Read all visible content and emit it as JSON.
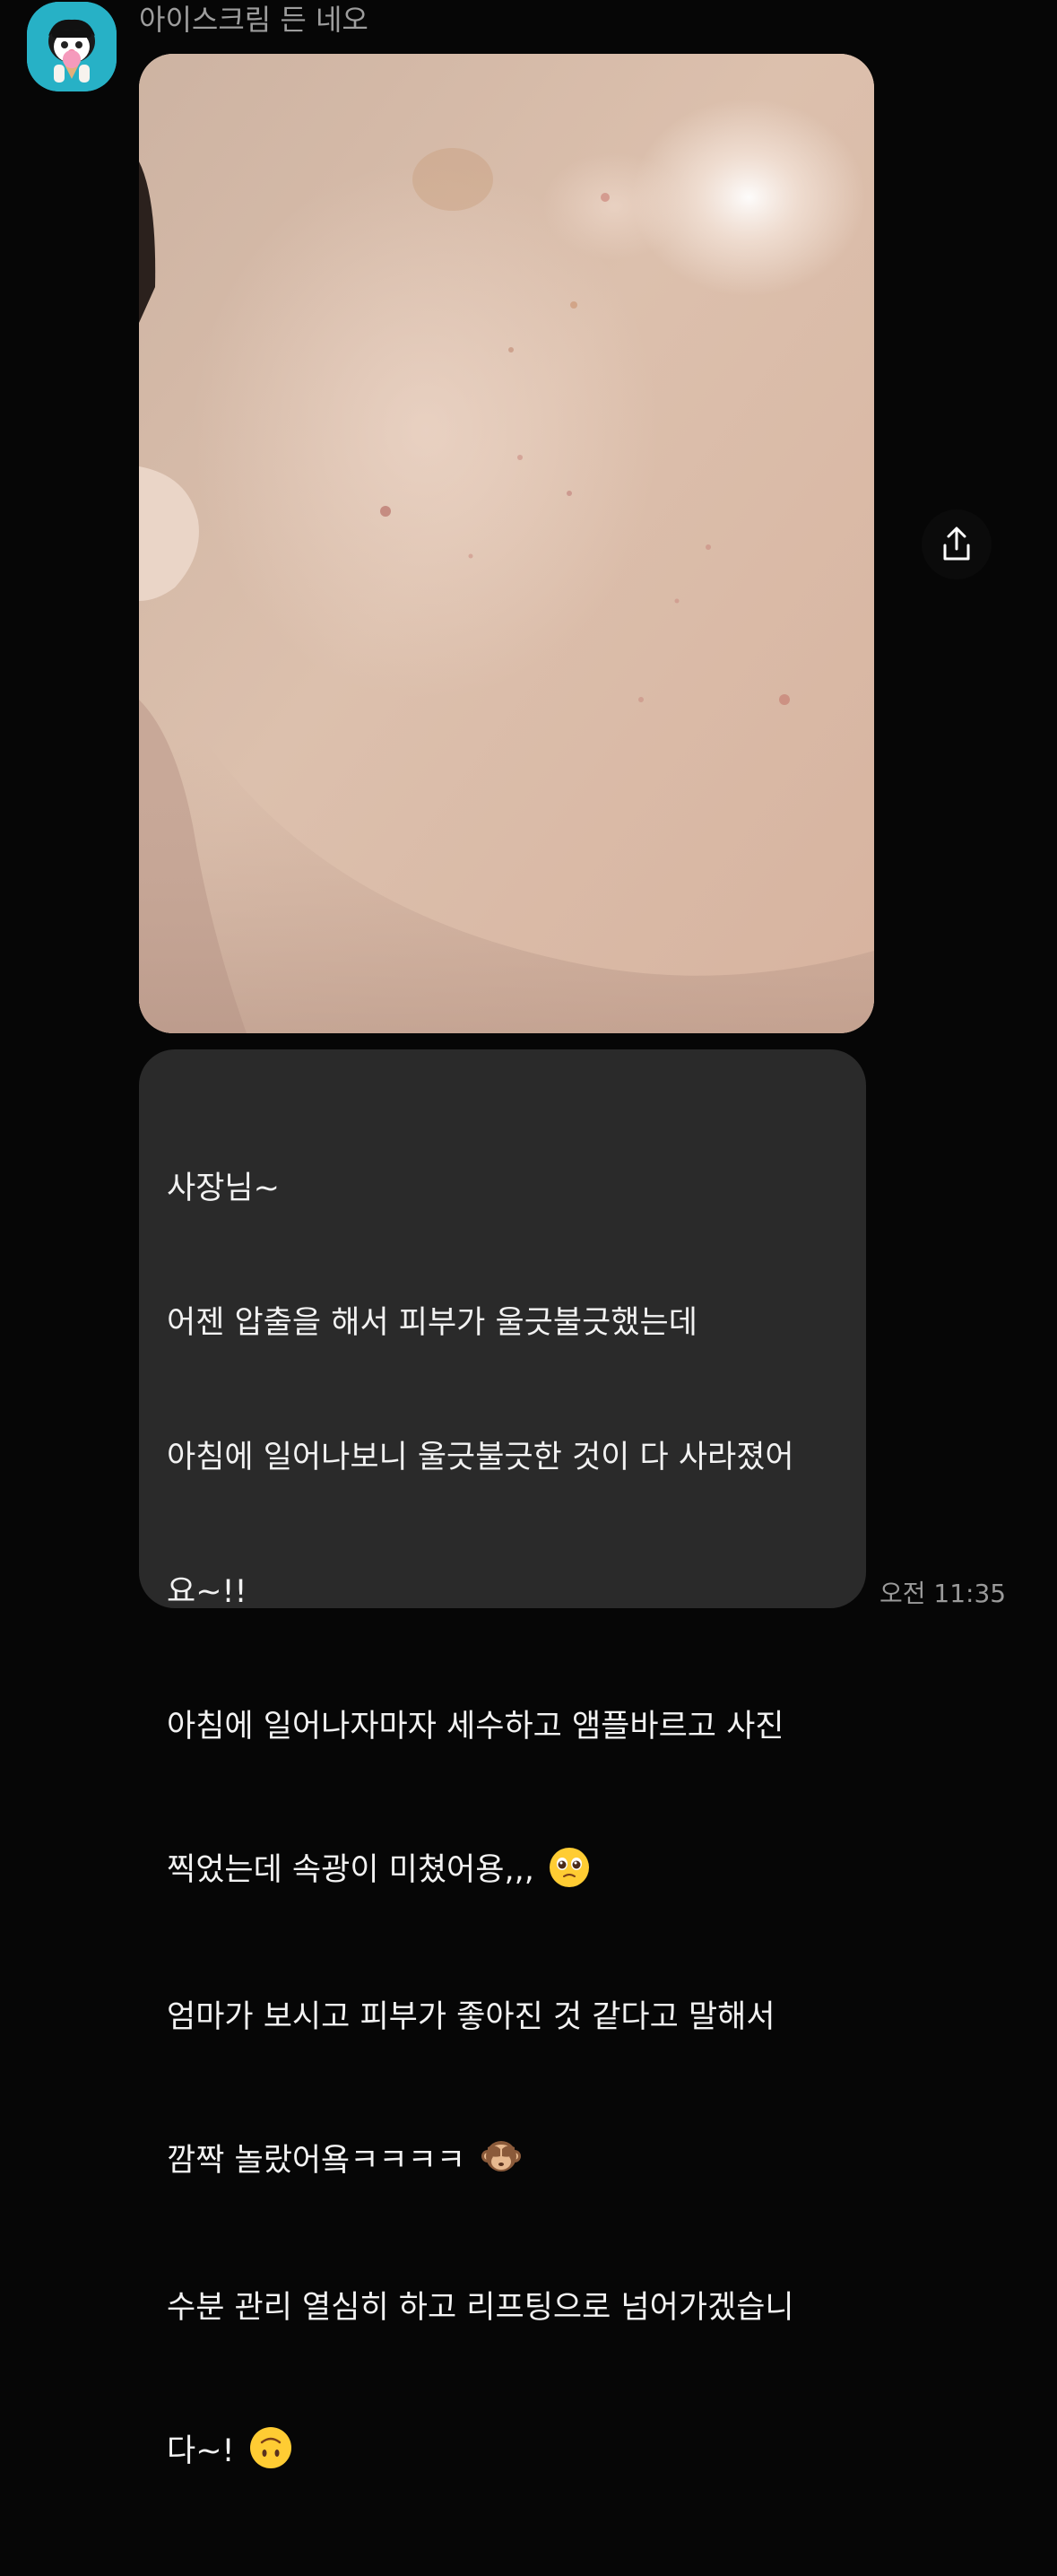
{
  "chat": {
    "sender_name": "아이스크림 든 네오",
    "time": "오전 11:35",
    "message_lines": [
      "사장님~",
      "어젠 압출을 해서 피부가 울긋불긋했는데",
      "아침에 일어나보니 울긋불긋한 것이 다 사라졌어",
      "요~!!",
      "아침에 일어나자마자 세수하고 앰플바르고 사진",
      "찍었는데 속광이 미쳤어용,,,",
      "엄마가 보시고 피부가 좋아진 것 같다고 말해서",
      "깜짝 놀랐어욬ㅋㅋㅋㅋ",
      "수분 관리 열심히 하고 리프팅으로 넘어가겠습니",
      "다~!"
    ],
    "emojis": {
      "line6": "pleading-face",
      "line8": "see-no-evil-monkey",
      "line10": "upside-down-face"
    }
  },
  "icons": {
    "avatar": "neo-with-ice-cream-avatar",
    "share": "share-icon"
  },
  "colors": {
    "background": "#060606",
    "bubble": "#2a2a2a",
    "avatar_bg": "#27b1c6",
    "text_primary": "#f2f2f2",
    "text_secondary": "#9d9d9d"
  }
}
